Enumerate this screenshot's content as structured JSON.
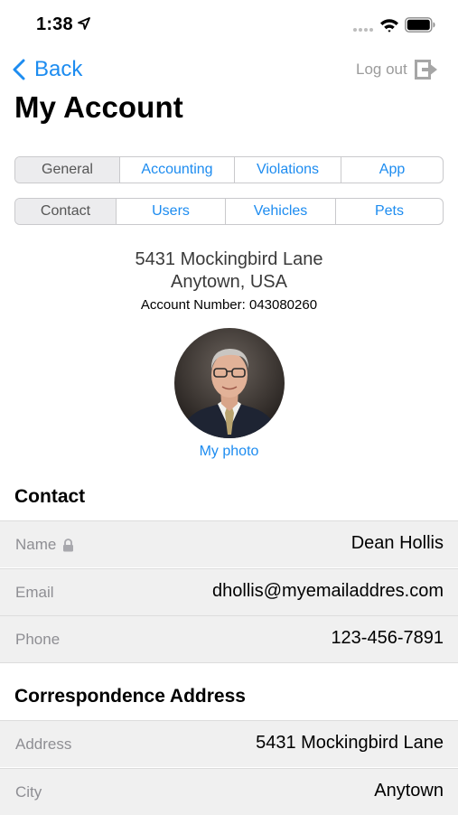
{
  "status": {
    "time": "1:38"
  },
  "nav": {
    "back_label": "Back",
    "logout_label": "Log out"
  },
  "page": {
    "title": "My Account"
  },
  "tabs_row1": [
    {
      "label": "General",
      "selected": true
    },
    {
      "label": "Accounting",
      "selected": false
    },
    {
      "label": "Violations",
      "selected": false
    },
    {
      "label": "App",
      "selected": false
    }
  ],
  "tabs_row2": [
    {
      "label": "Contact",
      "selected": true
    },
    {
      "label": "Users",
      "selected": false
    },
    {
      "label": "Vehicles",
      "selected": false
    },
    {
      "label": "Pets",
      "selected": false
    }
  ],
  "account": {
    "address_line1": "5431 Mockingbird Lane",
    "address_line2": "Anytown, USA",
    "account_number": "Account Number: 043080260",
    "photo_link": "My photo"
  },
  "contact": {
    "header": "Contact",
    "rows": [
      {
        "label": "Name",
        "value": "Dean Hollis",
        "locked": true
      },
      {
        "label": "Email",
        "value": "dhollis@myemailaddres.com"
      },
      {
        "label": "Phone",
        "value": "123-456-7891"
      }
    ]
  },
  "correspondence": {
    "header": "Correspondence Address",
    "rows": [
      {
        "label": "Address",
        "value": "5431 Mockingbird Lane"
      },
      {
        "label": "City",
        "value": "Anytown"
      }
    ]
  },
  "colors": {
    "accent": "#1d8cf0",
    "label_gray": "#8e8e93",
    "row_background": "#f0f0f0",
    "segment_selected": "#ececee"
  },
  "icons": [
    "location-arrow-icon",
    "signal-icon",
    "wifi-icon",
    "battery-icon",
    "chevron-left-icon",
    "logout-icon",
    "lock-icon"
  ]
}
